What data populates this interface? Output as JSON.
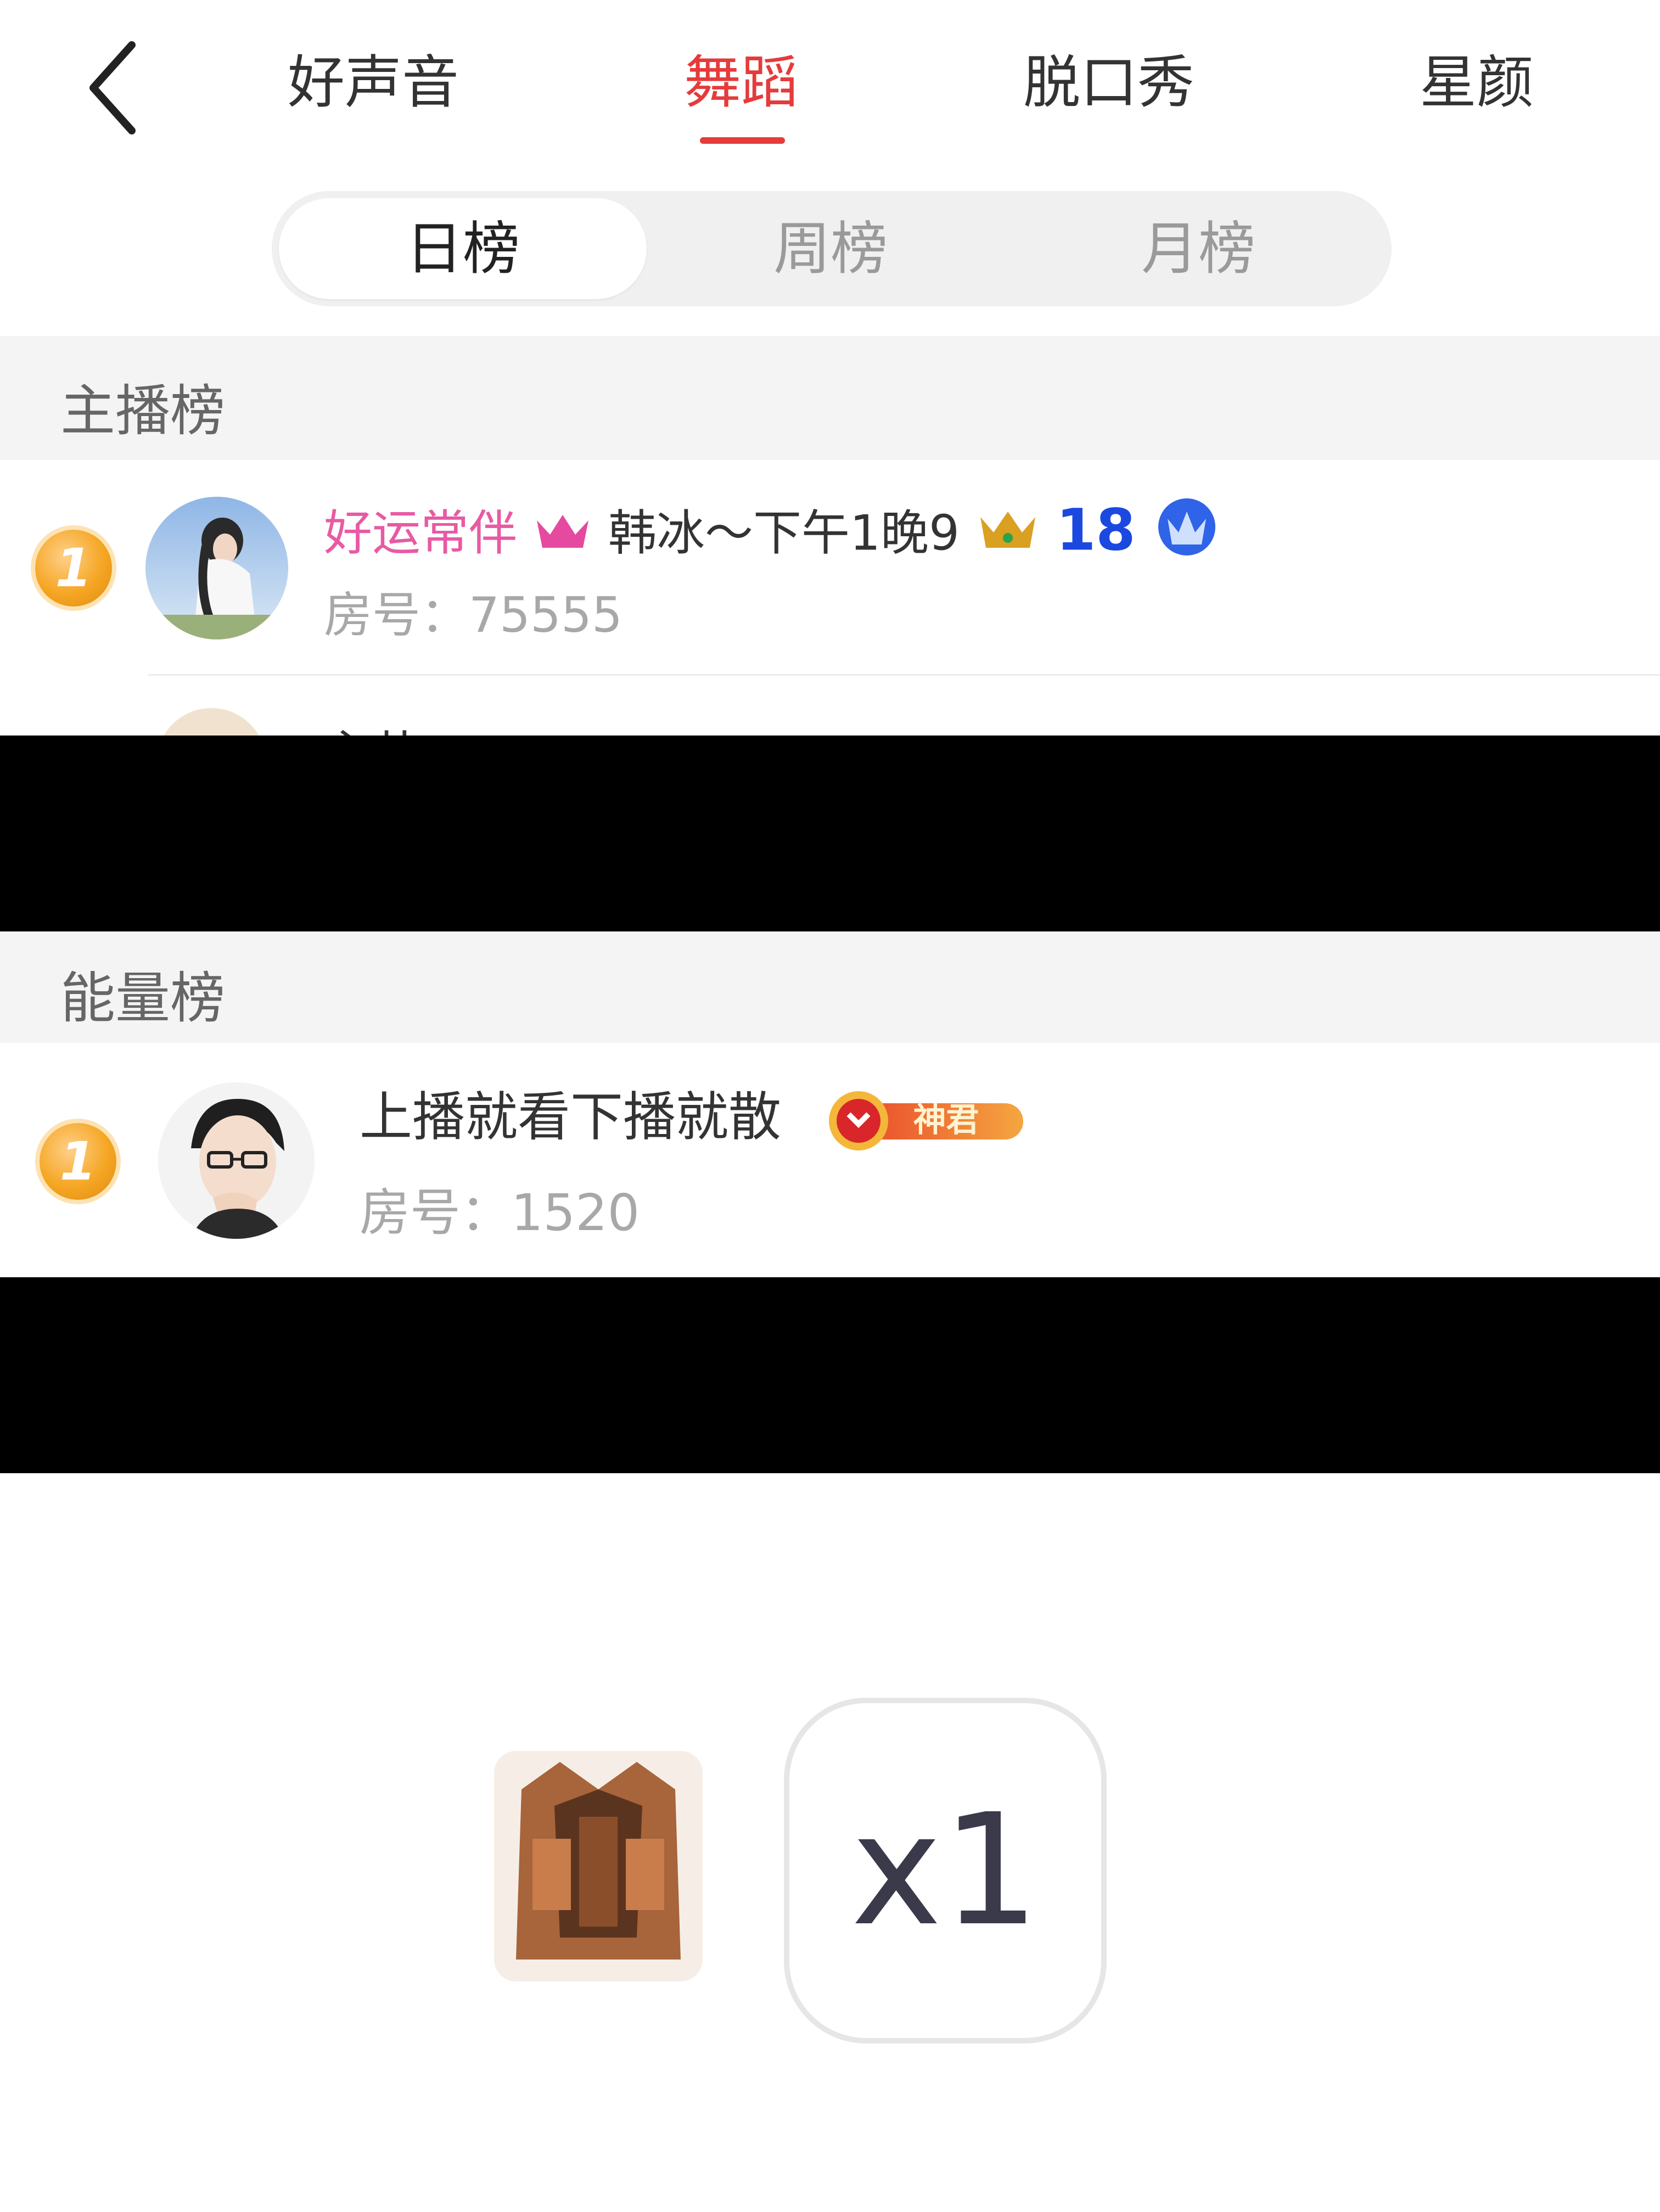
{
  "nav": {
    "back_icon": "chevron-left-icon",
    "tabs": [
      {
        "label": "好声音",
        "active": false
      },
      {
        "label": "舞蹈",
        "active": true
      },
      {
        "label": "脱口秀",
        "active": false
      },
      {
        "label": "星颜",
        "active": false
      }
    ]
  },
  "period_tabs": [
    {
      "label": "日榜",
      "active": true
    },
    {
      "label": "周榜",
      "active": false
    },
    {
      "label": "月榜",
      "active": false
    }
  ],
  "host_section": {
    "title": "主播榜",
    "rows": [
      {
        "rank": "1",
        "name_pink": "好运常伴",
        "name_rest": "韩冰～下午1晚9",
        "level": "18",
        "room_label": "房号：",
        "room_number": "75555"
      }
    ],
    "partial_row_text": "心儿~"
  },
  "energy_section": {
    "title": "能量榜",
    "rows": [
      {
        "rank": "1",
        "name": "上播就看下播就散",
        "badge_label": "神君",
        "room_label": "房号：",
        "room_number": "1520"
      }
    ]
  },
  "gift": {
    "count_label": "x1"
  },
  "colors": {
    "accent_red": "#e53b3b",
    "pink_name": "#e85aa3",
    "level_blue": "#1b49e0",
    "rank_gold": "#f5a623"
  }
}
